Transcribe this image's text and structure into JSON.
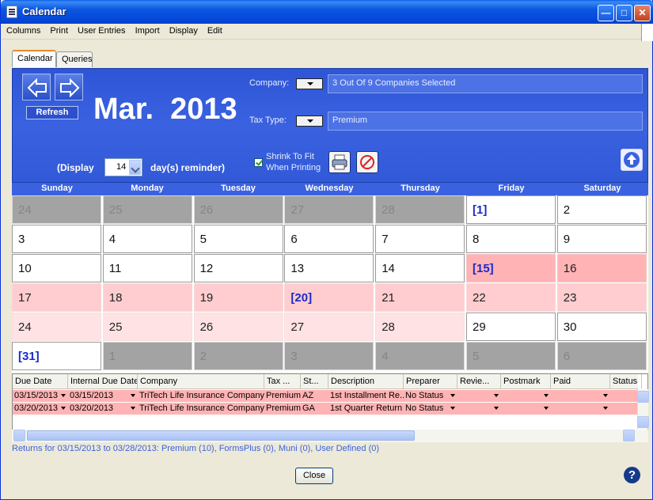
{
  "window": {
    "title": "Calendar"
  },
  "menu": [
    "Columns",
    "Print",
    "User Entries",
    "Import",
    "Display",
    "Edit"
  ],
  "tabs": [
    {
      "label": "Calendar",
      "active": true
    },
    {
      "label": "Queries",
      "active": false
    }
  ],
  "header": {
    "refresh_label": "Refresh",
    "month_year": "Mar.  2013",
    "company_label": "Company:",
    "company_value": "3 Out Of 9 Companies Selected",
    "taxtype_label": "Tax Type:",
    "taxtype_value": "Premium",
    "display_prefix": "(Display",
    "display_suffix": "day(s) reminder)",
    "reminder_days": "14",
    "shrink_label_1": "Shrink To Fit",
    "shrink_label_2": "When Printing"
  },
  "calendar": {
    "day_names": [
      "Sunday",
      "Monday",
      "Tuesday",
      "Wednesday",
      "Thursday",
      "Friday",
      "Saturday"
    ],
    "weeks": [
      [
        [
          "24",
          "gray"
        ],
        [
          "25",
          "gray"
        ],
        [
          "26",
          "gray"
        ],
        [
          "27",
          "gray"
        ],
        [
          "28",
          "gray"
        ],
        [
          "[1]",
          "white bold"
        ],
        [
          "2",
          "white"
        ]
      ],
      [
        [
          "3",
          "white"
        ],
        [
          "4",
          "white"
        ],
        [
          "5",
          "white"
        ],
        [
          "6",
          "white"
        ],
        [
          "7",
          "white"
        ],
        [
          "8",
          "white"
        ],
        [
          "9",
          "white"
        ]
      ],
      [
        [
          "10",
          "white"
        ],
        [
          "11",
          "white"
        ],
        [
          "12",
          "white"
        ],
        [
          "13",
          "white"
        ],
        [
          "14",
          "white"
        ],
        [
          "[15]",
          "pink1 bold"
        ],
        [
          "16",
          "pink1"
        ]
      ],
      [
        [
          "17",
          "pink2"
        ],
        [
          "18",
          "pink2"
        ],
        [
          "19",
          "pink2"
        ],
        [
          "[20]",
          "pink2 bold"
        ],
        [
          "21",
          "pink2"
        ],
        [
          "22",
          "pink2"
        ],
        [
          "23",
          "pink2"
        ]
      ],
      [
        [
          "24",
          "pink3"
        ],
        [
          "25",
          "pink3"
        ],
        [
          "26",
          "pink3"
        ],
        [
          "27",
          "pink3"
        ],
        [
          "28",
          "pink3"
        ],
        [
          "29",
          "white"
        ],
        [
          "30",
          "white"
        ]
      ],
      [
        [
          "[31]",
          "white bold"
        ],
        [
          "1",
          "gray"
        ],
        [
          "2",
          "gray"
        ],
        [
          "3",
          "gray"
        ],
        [
          "4",
          "gray"
        ],
        [
          "5",
          "gray"
        ],
        [
          "6",
          "gray"
        ]
      ]
    ]
  },
  "table": {
    "columns": [
      "Due Date",
      "Internal Due Date",
      "Company",
      "Tax ...",
      "St...",
      "Description",
      "Preparer",
      "Revie...",
      "Postmark",
      "Paid",
      "Status"
    ],
    "rows": [
      [
        "03/15/2013",
        "03/15/2013",
        "TriTech Life Insurance Company",
        "Premium",
        "AZ",
        "1st Installment Re...",
        "No Status",
        "",
        "",
        "",
        ""
      ],
      [
        "03/20/2013",
        "03/20/2013",
        "TriTech Life Insurance Company",
        "Premium",
        "GA",
        "1st Quarter Return",
        "No Status",
        "",
        "",
        "",
        ""
      ]
    ]
  },
  "status_text": "Returns for 03/15/2013 to 03/28/2013: Premium (10), FormsPlus (0), Muni (0), User Defined (0)",
  "close_label": "Close",
  "help_label": "?"
}
